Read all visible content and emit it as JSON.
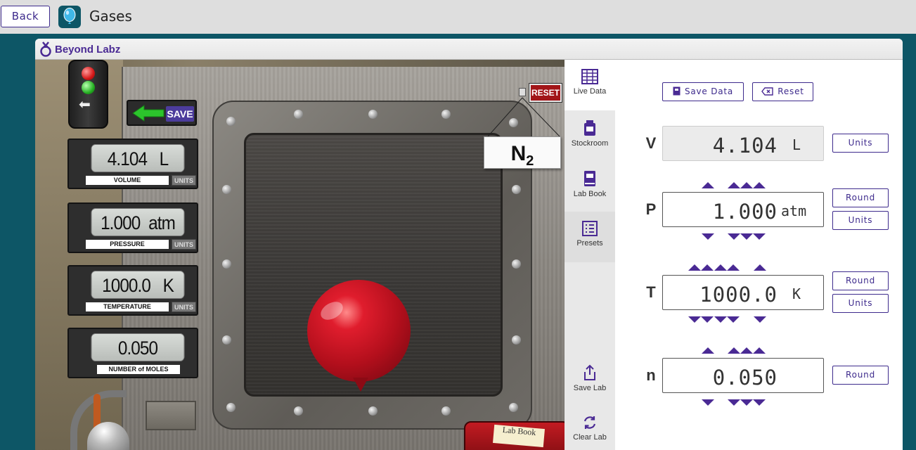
{
  "topbar": {
    "back_label": "Back",
    "title": "Gases"
  },
  "brand": {
    "name": "Beyond Labz"
  },
  "scene": {
    "save_sign": "SAVE",
    "reset_sign": "RESET",
    "gas_symbol": "N",
    "gas_subscript": "2",
    "lab_book_label": "Lab Book",
    "displays": [
      {
        "value": "4.104",
        "unit": "L",
        "label": "VOLUME",
        "units_button": "UNITS"
      },
      {
        "value": "1.000",
        "unit": "atm",
        "label": "PRESSURE",
        "units_button": "UNITS"
      },
      {
        "value": "1000.0",
        "unit": "K",
        "label": "TEMPERATURE",
        "units_button": "UNITS"
      },
      {
        "value": "0.050",
        "unit": "",
        "label": "NUMBER of MOLES",
        "units_button": ""
      }
    ]
  },
  "sidenav": [
    {
      "label": "Live Data",
      "icon": "table-grid-icon",
      "active": true
    },
    {
      "label": "Stockroom",
      "icon": "jar-icon"
    },
    {
      "label": "Lab Book",
      "icon": "book-icon"
    },
    {
      "label": "Presets",
      "icon": "list-icon"
    },
    {
      "label": "Save Lab",
      "icon": "share-upload-icon"
    },
    {
      "label": "Clear Lab",
      "icon": "refresh-icon"
    }
  ],
  "panel": {
    "save_data_label": "Save Data",
    "reset_label": "Reset",
    "variables": [
      {
        "symbol": "V",
        "value": "4.104",
        "unit": "L",
        "locked": true,
        "buttons": [
          "Units"
        ]
      },
      {
        "symbol": "P",
        "value": "1.000",
        "unit": "atm",
        "locked": false,
        "buttons": [
          "Round",
          "Units"
        ]
      },
      {
        "symbol": "T",
        "value": "1000.0",
        "unit": "K",
        "locked": false,
        "buttons": [
          "Round",
          "Units"
        ]
      },
      {
        "symbol": "n",
        "value": "0.050",
        "unit": "",
        "locked": false,
        "buttons": [
          "Round"
        ]
      }
    ]
  },
  "colors": {
    "accent": "#4a2a94",
    "frame_bg": "#0d5666",
    "balloon": "#c0111e"
  }
}
